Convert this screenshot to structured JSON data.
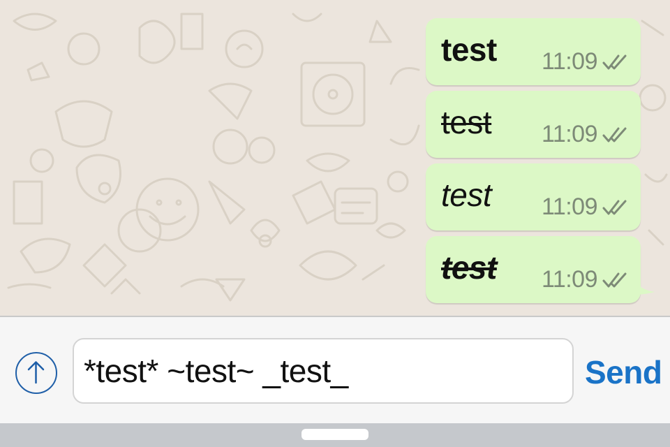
{
  "chat": {
    "messages": [
      {
        "text": "test",
        "format": "bold",
        "time": "11:09",
        "status_icon": "double-check-icon"
      },
      {
        "text": "test",
        "format": "strikethrough",
        "time": "11:09",
        "status_icon": "double-check-icon"
      },
      {
        "text": "test",
        "format": "italic",
        "time": "11:09",
        "status_icon": "double-check-icon"
      },
      {
        "text": "test",
        "format": "bold-italic-strikethrough",
        "time": "11:09",
        "status_icon": "double-check-icon"
      }
    ],
    "bubble_color": "#dcf8c6",
    "wallpaper_color": "#ece5dd"
  },
  "composer": {
    "attach_icon": "arrow-up-circle-icon",
    "input_value": "*test* ~test~ _test_",
    "send_label": "Send",
    "accent_color": "#1a73c7"
  },
  "home_indicator": {
    "icon": "home-handle"
  }
}
